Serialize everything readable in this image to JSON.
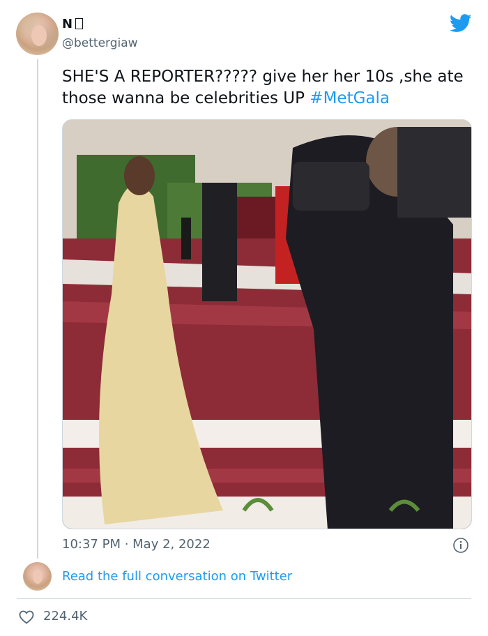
{
  "user": {
    "display_name": "N",
    "handle": "@bettergiaw"
  },
  "tweet": {
    "text": "SHE'S A REPORTER????? give her her 10s ,she ate those wanna be celebrities UP",
    "hashtag": "#MetGala",
    "timestamp": "10:37 PM · May 2, 2022",
    "read_link": "Read the full conversation on Twitter",
    "likes": "224.4K"
  },
  "icons": {
    "brand": "twitter-bird-icon",
    "info": "info-icon",
    "like": "heart-icon"
  },
  "colors": {
    "accent": "#1d9bf0",
    "secondary_text": "#536471",
    "primary_text": "#0f1419",
    "border": "#cfd9de"
  }
}
